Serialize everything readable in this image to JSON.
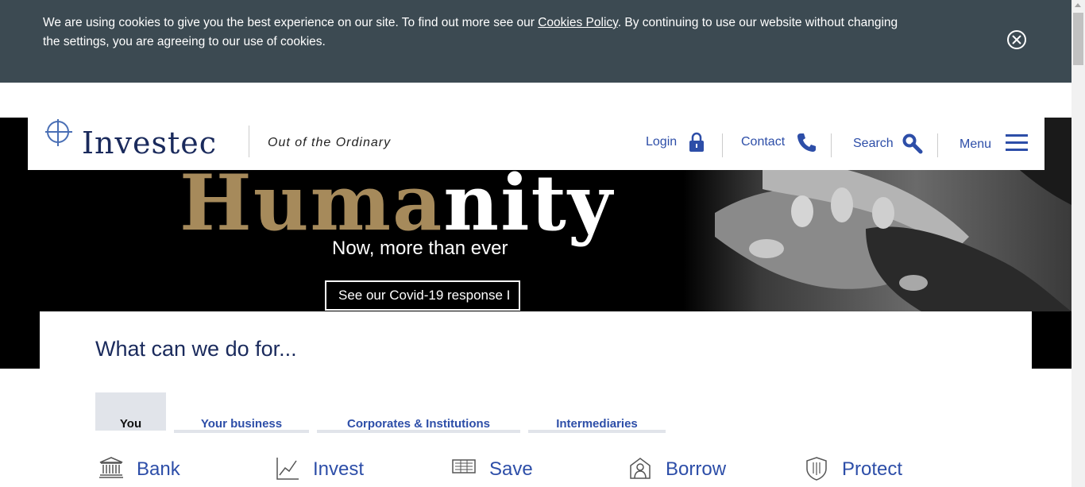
{
  "cookie_banner": {
    "text_before": "We are using cookies to give you the best experience on our site. To find out more see our ",
    "link_text": "Cookies Policy",
    "text_after": ". By continuing to use our website without changing the settings, you are agreeing to our use of cookies."
  },
  "header": {
    "brand": "Investec",
    "tagline": "Out of the Ordinary",
    "nav": {
      "login": "Login",
      "contact": "Contact",
      "search": "Search",
      "menu": "Menu"
    }
  },
  "hero": {
    "headline_gold": "Huma",
    "headline_white": "nity",
    "subline": "Now, more than ever",
    "cta": "See our Covid-19 response I"
  },
  "section": {
    "title": "What can we do for...",
    "tabs": [
      {
        "label": "You"
      },
      {
        "label": "Your business"
      },
      {
        "label": "Corporates & Institutions"
      },
      {
        "label": "Intermediaries"
      }
    ],
    "categories": [
      {
        "label": "Bank",
        "icon": "bank-icon"
      },
      {
        "label": "Invest",
        "icon": "chart-icon"
      },
      {
        "label": "Save",
        "icon": "save-icon"
      },
      {
        "label": "Borrow",
        "icon": "borrow-icon"
      },
      {
        "label": "Protect",
        "icon": "shield-icon"
      }
    ]
  },
  "colors": {
    "cookie_bg": "#3c4a52",
    "brand_navy": "#1a2a5c",
    "link_blue": "#2d4ea8",
    "gold": "#a68a5b",
    "tab_bg": "#e1e4ea"
  }
}
